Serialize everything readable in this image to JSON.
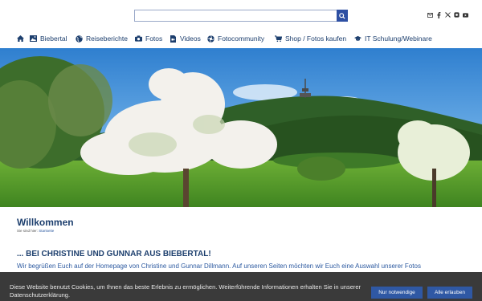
{
  "search": {
    "placeholder": "",
    "value": ""
  },
  "social": [
    "mail-icon",
    "facebook-icon",
    "x-icon",
    "instagram-icon",
    "youtube-icon"
  ],
  "nav": [
    {
      "label": "",
      "icon": "home-icon"
    },
    {
      "label": "Biebertal",
      "icon": "image-icon"
    },
    {
      "label": "Reiseberichte",
      "icon": "globe-icon"
    },
    {
      "label": "Fotos",
      "icon": "camera-icon"
    },
    {
      "label": "Videos",
      "icon": "film-file-icon"
    },
    {
      "label": "Fotocommunity",
      "icon": "aperture-icon"
    },
    {
      "label": "Shop / Fotos kaufen",
      "icon": "cart-icon"
    },
    {
      "label": "IT Schulung/Webinare",
      "icon": "graduation-cap-icon"
    }
  ],
  "main": {
    "title": "Willkommen",
    "breadcrumb_prefix": "Sie sind hier:",
    "breadcrumb_link": "Startseite",
    "headline": "... BEI CHRISTINE UND GUNNAR AUS BIEBERTAL!",
    "intro": "Wir begrüßen Euch auf der Homepage von Christine und Gunnar Dillmann. Auf unseren Seiten möchten wir Euch eine Auswahl unserer Fotos"
  },
  "cookie": {
    "text": "Diese Website benutzt Cookies, um Ihnen das beste Erlebnis zu ermöglichen. Weiterführende Informationen erhalten Sie in unserer Datenschutzerklärung.",
    "btn_necessary": "Nur notwendige",
    "btn_all": "Alle erlauben"
  },
  "colors": {
    "brand": "#1d3f6e",
    "button": "#2f58a4",
    "cookie_bg": "#3a3a3a"
  }
}
